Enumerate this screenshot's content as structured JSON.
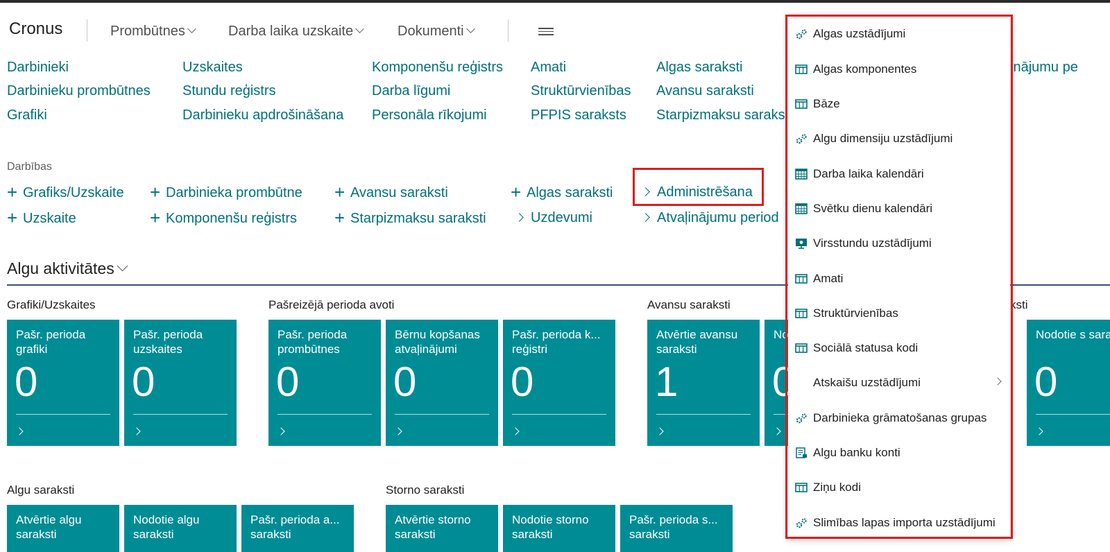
{
  "header": {
    "brand": "Cronus",
    "nav": [
      "Prombūtnes",
      "Darba laika uzskaite",
      "Dokumenti"
    ]
  },
  "links": {
    "col1": [
      "Darbinieki",
      "Darbinieku prombūtnes",
      "Grafiki"
    ],
    "col2": [
      "Uzskaites",
      "Stundu reģistrs",
      "Darbinieku apdrošināšana"
    ],
    "col3": [
      "Komponenšu reģistrs",
      "Darba līgumi",
      "Personāla rīkojumi"
    ],
    "col4": [
      "Amati",
      "Struktūrvienības",
      "PFPIS saraksts"
    ],
    "col5": [
      "Algas saraksti",
      "Avansu saraksti",
      "Starpizmaksu sarakst"
    ],
    "col6": [
      "ināj­umu pe"
    ]
  },
  "actions": {
    "label": "Darbības",
    "row1": [
      "Grafiks/Uzskaite",
      "Darbinieka prombūtne",
      "Avansu saraksti",
      "Algas saraksti",
      "Administrēšana"
    ],
    "row2": [
      "Uzskaite",
      "Komponenšu reģistrs",
      "Starpizmaksu saraksti",
      "Uzdevumi",
      "Atvaļinājumu period"
    ]
  },
  "activities": {
    "title": "Algu aktivitātes",
    "groups": {
      "g1": "Grafiki/Uzskaites",
      "g2": "Pašreizējā perioda avoti",
      "g3": "Avansu saraksti",
      "g4": "ksti",
      "g5": "Algu saraksti",
      "g6": "Storno saraksti"
    },
    "tiles": [
      {
        "name": "Pašr. perioda grafiki",
        "value": "0"
      },
      {
        "name": "Pašr. perioda uzskaites",
        "value": "0"
      },
      {
        "name": "Pašr. perioda prombūtnes",
        "value": "0"
      },
      {
        "name": "Bērnu kopšanas atvaļinājumi",
        "value": "0"
      },
      {
        "name": "Pašr. perioda k... reģistri",
        "value": "0"
      },
      {
        "name": "Atvērtie avansu saraksti",
        "value": "1"
      },
      {
        "name": "No sa",
        "value": "0"
      },
      {
        "name": "Nodotie s saraksti",
        "value": "0"
      }
    ],
    "tiles_bottom": [
      {
        "name": "Atvērtie algu saraksti"
      },
      {
        "name": "Nodotie algu saraksti"
      },
      {
        "name": "Pašr. perioda a... saraksti"
      },
      {
        "name": "Atvērtie storno saraksti"
      },
      {
        "name": "Nodotie storno saraksti"
      },
      {
        "name": "Pašr. perioda s... saraksti"
      }
    ]
  },
  "menu": {
    "items": [
      {
        "label": "Algas uzstādījumi",
        "icon": "gears-icon"
      },
      {
        "label": "Algas komponentes",
        "icon": "table-icon"
      },
      {
        "label": "Bāze",
        "icon": "table-icon"
      },
      {
        "label": "Algu dimensiju uzstādījumi",
        "icon": "gears-icon"
      },
      {
        "label": "Darba laika kalendāri",
        "icon": "calendar-grid-icon"
      },
      {
        "label": "Svētku dienu kalendāri",
        "icon": "calendar-grid-icon"
      },
      {
        "label": "Virsstundu uzstādījumi",
        "icon": "monitor-gear-icon"
      },
      {
        "label": "Amati",
        "icon": "table-icon"
      },
      {
        "label": "Struktūrvienības",
        "icon": "table-icon"
      },
      {
        "label": "Sociālā statusa kodi",
        "icon": "table-icon"
      },
      {
        "label": "Atskaišu uzstādījumi",
        "icon": "submenu-chevron-icon"
      },
      {
        "label": "Darbinieka grāmatošanas grupas",
        "icon": "gears-icon"
      },
      {
        "label": "Algu banku konti",
        "icon": "bank-document-icon"
      },
      {
        "label": "Ziņu kodi",
        "icon": "table-icon"
      },
      {
        "label": "Slimības lapas importa uzstādījumi",
        "icon": "gears-icon"
      }
    ]
  },
  "colors": {
    "accent": "#00707a",
    "tile": "#008c95",
    "highlight": "#e31b1b"
  }
}
